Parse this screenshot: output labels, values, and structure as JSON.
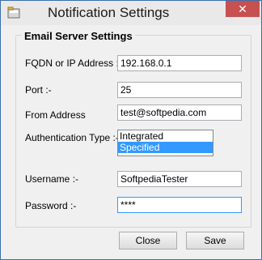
{
  "window": {
    "title": "Notification Settings",
    "close_glyph": "✕"
  },
  "group": {
    "legend": "Email Server Settings"
  },
  "fields": {
    "fqdn": {
      "label": "FQDN or IP Address :-",
      "value": "192.168.0.1"
    },
    "port": {
      "label": "Port :-",
      "value": "25"
    },
    "from": {
      "label": "From Address",
      "value": "test@softpedia.com"
    },
    "auth": {
      "label": "Authentication Type :-",
      "options": [
        "Integrated",
        "Specified"
      ],
      "selected": "Specified"
    },
    "username": {
      "label": "Username :-",
      "value": "SoftpediaTester"
    },
    "password": {
      "label": "Password :-",
      "value": "****"
    }
  },
  "buttons": {
    "close": "Close",
    "save": "Save"
  },
  "colors": {
    "accent": "#3399ff",
    "close_button": "#c75050"
  },
  "icons": {
    "app": "app-icon"
  }
}
